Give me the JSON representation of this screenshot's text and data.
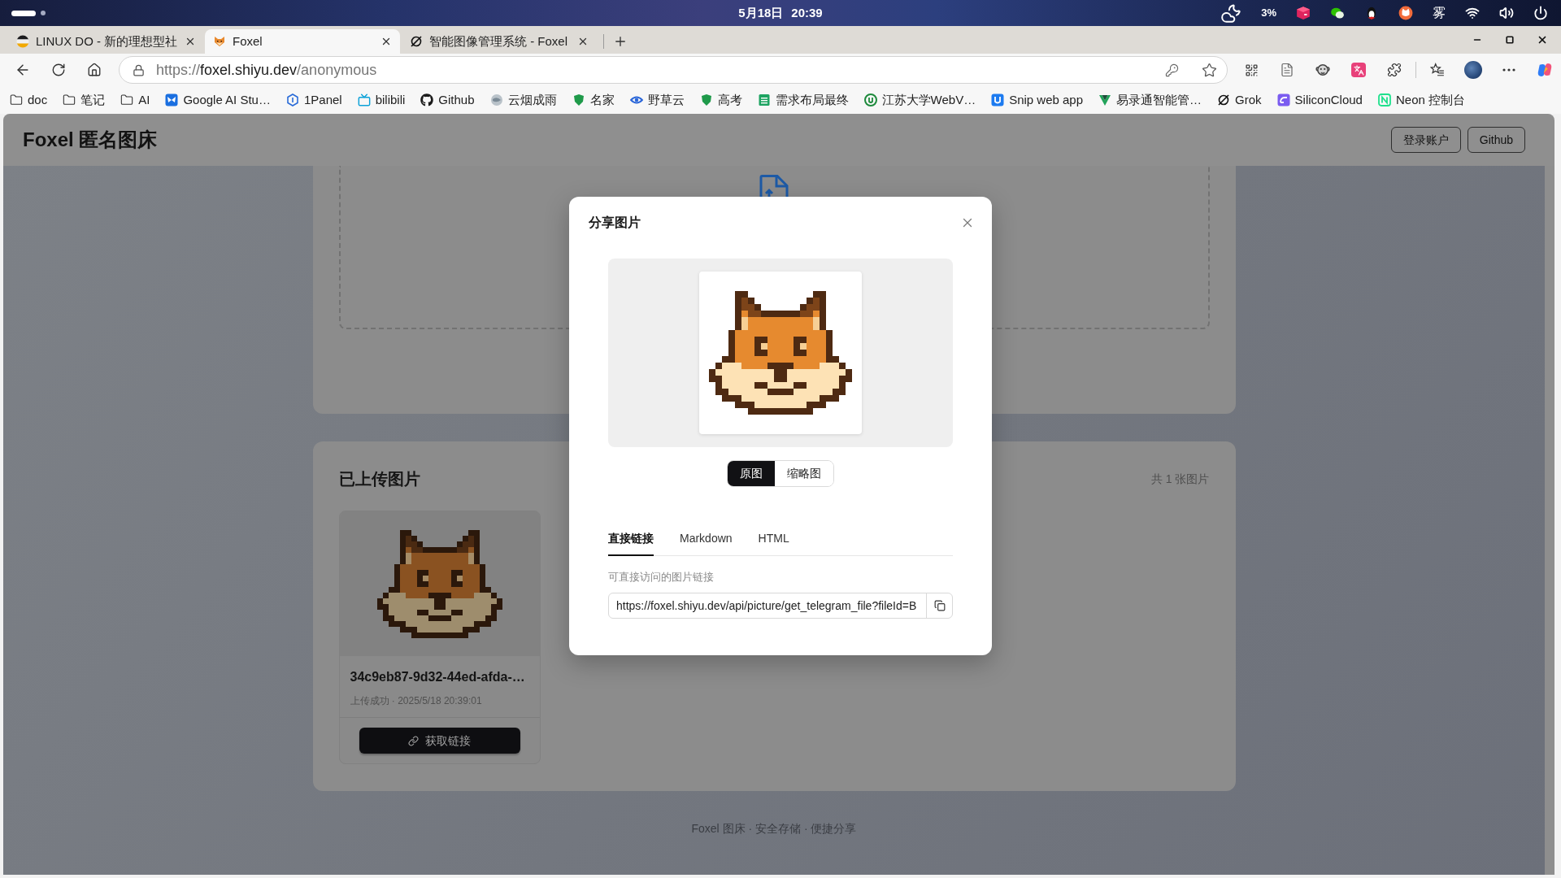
{
  "system_bar": {
    "date": "5月18日",
    "time": "20:39",
    "tray_reading": "3%",
    "tray_text": "雾"
  },
  "browser": {
    "tabs": [
      {
        "title": "LINUX DO - 新的理想型社",
        "selected": false
      },
      {
        "title": "Foxel",
        "selected": true
      },
      {
        "title": "智能图像管理系统 - Foxel",
        "selected": false
      }
    ],
    "address": {
      "scheme": "https://",
      "host": "foxel.shiyu.dev",
      "path": "/anonymous"
    },
    "bookmarks": [
      {
        "kind": "folder",
        "label": "doc"
      },
      {
        "kind": "folder",
        "label": "笔记"
      },
      {
        "kind": "folder",
        "label": "AI"
      },
      {
        "kind": "link",
        "label": "Google AI Stu…"
      },
      {
        "kind": "link",
        "label": "1Panel"
      },
      {
        "kind": "link",
        "label": "bilibili"
      },
      {
        "kind": "link",
        "label": "Github"
      },
      {
        "kind": "link",
        "label": "云烟成雨"
      },
      {
        "kind": "link",
        "label": "名家"
      },
      {
        "kind": "link",
        "label": "野草云"
      },
      {
        "kind": "link",
        "label": "高考"
      },
      {
        "kind": "link",
        "label": "需求布局最终"
      },
      {
        "kind": "link",
        "label": "江苏大学WebV…"
      },
      {
        "kind": "link",
        "label": "Snip web app"
      },
      {
        "kind": "link",
        "label": "易录通智能管…"
      },
      {
        "kind": "link",
        "label": "Grok"
      },
      {
        "kind": "link",
        "label": "SiliconCloud"
      },
      {
        "kind": "link",
        "label": "Neon 控制台"
      }
    ]
  },
  "page": {
    "header": {
      "title": "Foxel 匿名图床",
      "buttons": [
        "登录账户",
        "Github"
      ]
    },
    "uploaded": {
      "title": "已上传图片",
      "count": "共 1 张图片",
      "images": [
        {
          "filename": "34c9eb87-9d32-44ed-afda-…",
          "status": "上传成功 · 2025/5/18 20:39:01",
          "button": "获取链接"
        }
      ]
    },
    "footer": "Foxel 图床 · 安全存储 · 便捷分享"
  },
  "share_dialog": {
    "title": "分享图片",
    "image_modes": [
      {
        "label": "原图",
        "selected": true
      },
      {
        "label": "缩略图",
        "selected": false
      }
    ],
    "tabs": [
      {
        "label": "直接链接",
        "selected": true
      },
      {
        "label": "Markdown",
        "selected": false
      },
      {
        "label": "HTML",
        "selected": false
      }
    ],
    "field_label": "可直接访问的图片链接",
    "link": "https://foxel.shiyu.dev/api/picture/get_telegram_file?fileId=B"
  }
}
